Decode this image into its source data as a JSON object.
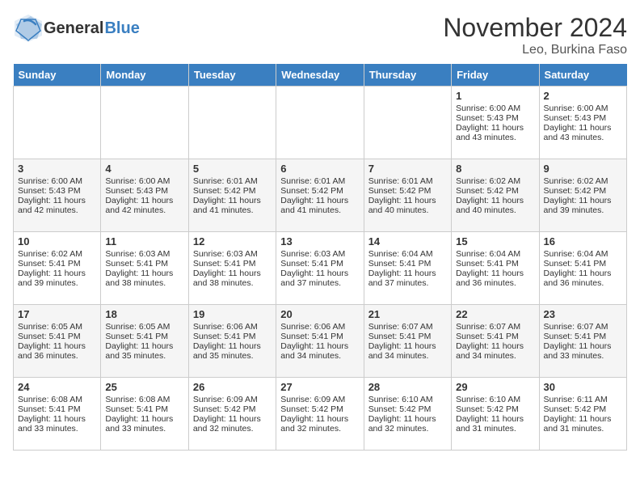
{
  "header": {
    "logo_general": "General",
    "logo_blue": "Blue",
    "month_title": "November 2024",
    "location": "Leo, Burkina Faso"
  },
  "days_of_week": [
    "Sunday",
    "Monday",
    "Tuesday",
    "Wednesday",
    "Thursday",
    "Friday",
    "Saturday"
  ],
  "weeks": [
    [
      {
        "day": "",
        "empty": true
      },
      {
        "day": "",
        "empty": true
      },
      {
        "day": "",
        "empty": true
      },
      {
        "day": "",
        "empty": true
      },
      {
        "day": "",
        "empty": true
      },
      {
        "day": "1",
        "sunrise": "Sunrise: 6:00 AM",
        "sunset": "Sunset: 5:43 PM",
        "daylight": "Daylight: 11 hours and 43 minutes."
      },
      {
        "day": "2",
        "sunrise": "Sunrise: 6:00 AM",
        "sunset": "Sunset: 5:43 PM",
        "daylight": "Daylight: 11 hours and 43 minutes."
      }
    ],
    [
      {
        "day": "3",
        "sunrise": "Sunrise: 6:00 AM",
        "sunset": "Sunset: 5:43 PM",
        "daylight": "Daylight: 11 hours and 42 minutes."
      },
      {
        "day": "4",
        "sunrise": "Sunrise: 6:00 AM",
        "sunset": "Sunset: 5:43 PM",
        "daylight": "Daylight: 11 hours and 42 minutes."
      },
      {
        "day": "5",
        "sunrise": "Sunrise: 6:01 AM",
        "sunset": "Sunset: 5:42 PM",
        "daylight": "Daylight: 11 hours and 41 minutes."
      },
      {
        "day": "6",
        "sunrise": "Sunrise: 6:01 AM",
        "sunset": "Sunset: 5:42 PM",
        "daylight": "Daylight: 11 hours and 41 minutes."
      },
      {
        "day": "7",
        "sunrise": "Sunrise: 6:01 AM",
        "sunset": "Sunset: 5:42 PM",
        "daylight": "Daylight: 11 hours and 40 minutes."
      },
      {
        "day": "8",
        "sunrise": "Sunrise: 6:02 AM",
        "sunset": "Sunset: 5:42 PM",
        "daylight": "Daylight: 11 hours and 40 minutes."
      },
      {
        "day": "9",
        "sunrise": "Sunrise: 6:02 AM",
        "sunset": "Sunset: 5:42 PM",
        "daylight": "Daylight: 11 hours and 39 minutes."
      }
    ],
    [
      {
        "day": "10",
        "sunrise": "Sunrise: 6:02 AM",
        "sunset": "Sunset: 5:41 PM",
        "daylight": "Daylight: 11 hours and 39 minutes."
      },
      {
        "day": "11",
        "sunrise": "Sunrise: 6:03 AM",
        "sunset": "Sunset: 5:41 PM",
        "daylight": "Daylight: 11 hours and 38 minutes."
      },
      {
        "day": "12",
        "sunrise": "Sunrise: 6:03 AM",
        "sunset": "Sunset: 5:41 PM",
        "daylight": "Daylight: 11 hours and 38 minutes."
      },
      {
        "day": "13",
        "sunrise": "Sunrise: 6:03 AM",
        "sunset": "Sunset: 5:41 PM",
        "daylight": "Daylight: 11 hours and 37 minutes."
      },
      {
        "day": "14",
        "sunrise": "Sunrise: 6:04 AM",
        "sunset": "Sunset: 5:41 PM",
        "daylight": "Daylight: 11 hours and 37 minutes."
      },
      {
        "day": "15",
        "sunrise": "Sunrise: 6:04 AM",
        "sunset": "Sunset: 5:41 PM",
        "daylight": "Daylight: 11 hours and 36 minutes."
      },
      {
        "day": "16",
        "sunrise": "Sunrise: 6:04 AM",
        "sunset": "Sunset: 5:41 PM",
        "daylight": "Daylight: 11 hours and 36 minutes."
      }
    ],
    [
      {
        "day": "17",
        "sunrise": "Sunrise: 6:05 AM",
        "sunset": "Sunset: 5:41 PM",
        "daylight": "Daylight: 11 hours and 36 minutes."
      },
      {
        "day": "18",
        "sunrise": "Sunrise: 6:05 AM",
        "sunset": "Sunset: 5:41 PM",
        "daylight": "Daylight: 11 hours and 35 minutes."
      },
      {
        "day": "19",
        "sunrise": "Sunrise: 6:06 AM",
        "sunset": "Sunset: 5:41 PM",
        "daylight": "Daylight: 11 hours and 35 minutes."
      },
      {
        "day": "20",
        "sunrise": "Sunrise: 6:06 AM",
        "sunset": "Sunset: 5:41 PM",
        "daylight": "Daylight: 11 hours and 34 minutes."
      },
      {
        "day": "21",
        "sunrise": "Sunrise: 6:07 AM",
        "sunset": "Sunset: 5:41 PM",
        "daylight": "Daylight: 11 hours and 34 minutes."
      },
      {
        "day": "22",
        "sunrise": "Sunrise: 6:07 AM",
        "sunset": "Sunset: 5:41 PM",
        "daylight": "Daylight: 11 hours and 34 minutes."
      },
      {
        "day": "23",
        "sunrise": "Sunrise: 6:07 AM",
        "sunset": "Sunset: 5:41 PM",
        "daylight": "Daylight: 11 hours and 33 minutes."
      }
    ],
    [
      {
        "day": "24",
        "sunrise": "Sunrise: 6:08 AM",
        "sunset": "Sunset: 5:41 PM",
        "daylight": "Daylight: 11 hours and 33 minutes."
      },
      {
        "day": "25",
        "sunrise": "Sunrise: 6:08 AM",
        "sunset": "Sunset: 5:41 PM",
        "daylight": "Daylight: 11 hours and 33 minutes."
      },
      {
        "day": "26",
        "sunrise": "Sunrise: 6:09 AM",
        "sunset": "Sunset: 5:42 PM",
        "daylight": "Daylight: 11 hours and 32 minutes."
      },
      {
        "day": "27",
        "sunrise": "Sunrise: 6:09 AM",
        "sunset": "Sunset: 5:42 PM",
        "daylight": "Daylight: 11 hours and 32 minutes."
      },
      {
        "day": "28",
        "sunrise": "Sunrise: 6:10 AM",
        "sunset": "Sunset: 5:42 PM",
        "daylight": "Daylight: 11 hours and 32 minutes."
      },
      {
        "day": "29",
        "sunrise": "Sunrise: 6:10 AM",
        "sunset": "Sunset: 5:42 PM",
        "daylight": "Daylight: 11 hours and 31 minutes."
      },
      {
        "day": "30",
        "sunrise": "Sunrise: 6:11 AM",
        "sunset": "Sunset: 5:42 PM",
        "daylight": "Daylight: 11 hours and 31 minutes."
      }
    ]
  ]
}
